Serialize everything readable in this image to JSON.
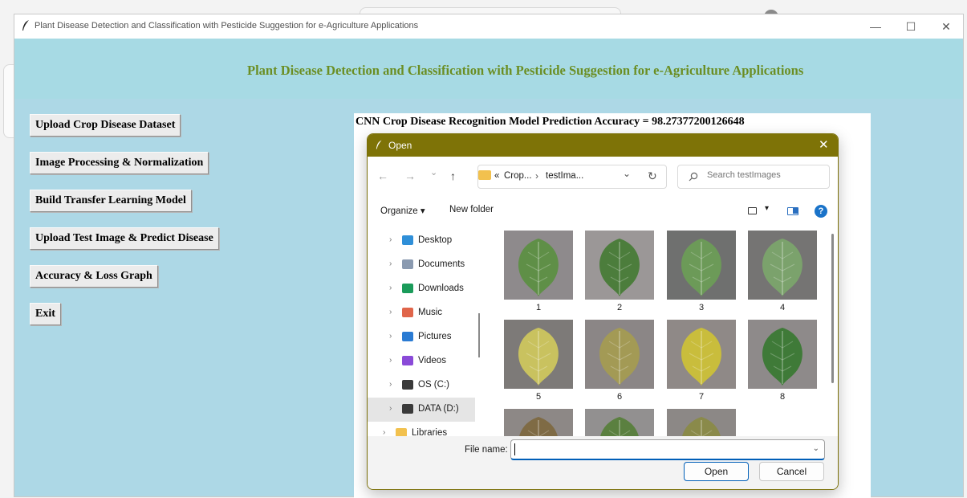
{
  "window": {
    "title": "Plant Disease Detection and Classification with Pesticide Suggestion for e-Agriculture Applications",
    "minimize": "—",
    "maximize": "☐",
    "close": "✕"
  },
  "app": {
    "heading": "Plant Disease Detection and Classification with Pesticide Suggestion for e-Agriculture Applications",
    "heading_color": "#6b8e23",
    "background_color": "#add8e6",
    "buttons": [
      {
        "label": "Upload Crop Disease Dataset"
      },
      {
        "label": "Image Processing & Normalization"
      },
      {
        "label": "Build Transfer Learning Model"
      },
      {
        "label": "Upload Test Image & Predict Disease"
      },
      {
        "label": "Accuracy & Loss Graph"
      },
      {
        "label": "Exit"
      }
    ],
    "output_text": "CNN Crop Disease Recognition Model Prediction Accuracy = 98.27377200126648"
  },
  "dialog": {
    "title": "Open",
    "title_bar_color": "#7e7307",
    "close": "✕",
    "nav": {
      "back": "←",
      "forward": "→",
      "recent": "⌄",
      "up": "↑",
      "refresh": "↻"
    },
    "address": {
      "prefix": "«",
      "crumb1": "Crop...",
      "separator": "›",
      "crumb2": "testIma...",
      "dropdown": "⌄"
    },
    "search": {
      "placeholder": "Search testImages"
    },
    "command_bar": {
      "organize": "Organize ▾",
      "new_folder": "New folder",
      "view_dropdown": "▾",
      "help": "?"
    },
    "tree": [
      {
        "label": "Desktop",
        "icon": "desktop-icon",
        "color": "#2f8fd8"
      },
      {
        "label": "Documents",
        "icon": "documents-icon",
        "color": "#8a9ab0"
      },
      {
        "label": "Downloads",
        "icon": "downloads-icon",
        "color": "#1a9b5a"
      },
      {
        "label": "Music",
        "icon": "music-icon",
        "color": "#e0654a"
      },
      {
        "label": "Pictures",
        "icon": "pictures-icon",
        "color": "#2a7bd3"
      },
      {
        "label": "Videos",
        "icon": "videos-icon",
        "color": "#8a4ad8"
      },
      {
        "label": "OS (C:)",
        "icon": "drive-icon",
        "color": "#3a3a3a"
      },
      {
        "label": "DATA (D:)",
        "icon": "drive-icon",
        "color": "#3a3a3a",
        "selected": true
      },
      {
        "label": "Libraries",
        "icon": "folder-icon",
        "color": "#f2c14e"
      }
    ],
    "files": [
      {
        "name": "1",
        "leaf_color": "#5f8f47",
        "bg_color": "#8e8a8c"
      },
      {
        "name": "2",
        "leaf_color": "#4c7d3c",
        "bg_color": "#9b9797"
      },
      {
        "name": "3",
        "leaf_color": "#6c9a58",
        "bg_color": "#6f706f"
      },
      {
        "name": "4",
        "leaf_color": "#7ba26c",
        "bg_color": "#757473"
      },
      {
        "name": "5",
        "leaf_color": "#c9c25f",
        "bg_color": "#7d7a78"
      },
      {
        "name": "6",
        "leaf_color": "#a39a55",
        "bg_color": "#8b8686"
      },
      {
        "name": "7",
        "leaf_color": "#c9bd3c",
        "bg_color": "#8f8987"
      },
      {
        "name": "8",
        "leaf_color": "#3f7a38",
        "bg_color": "#8e8a8a"
      },
      {
        "name": "",
        "leaf_color": "#7f6b45",
        "bg_color": "#8d8886"
      },
      {
        "name": "",
        "leaf_color": "#5b8040",
        "bg_color": "#929090"
      },
      {
        "name": "",
        "leaf_color": "#8a8a4a",
        "bg_color": "#8c8886"
      }
    ],
    "file_name_label": "File name:",
    "file_name_value": "",
    "open_button": "Open",
    "cancel_button": "Cancel"
  }
}
